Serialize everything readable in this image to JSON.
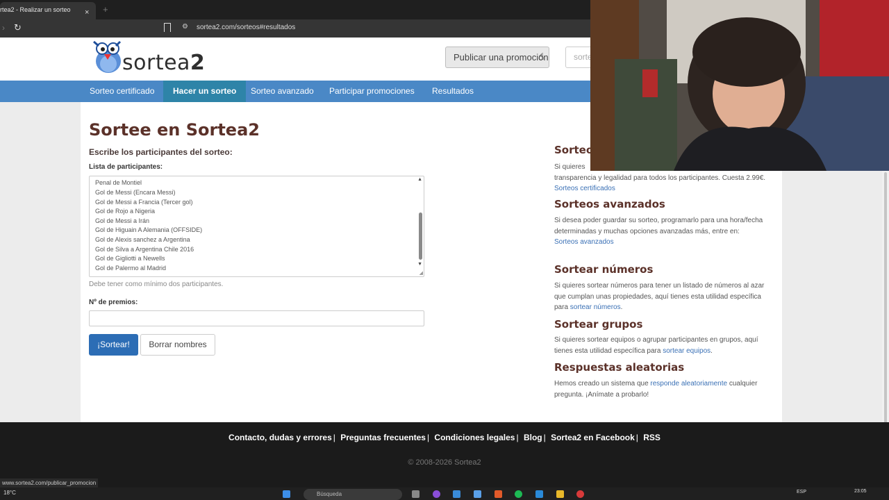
{
  "browser": {
    "tab_title": "rtea2 - Realizar un sorteo",
    "tab_close": "×",
    "new_tab": "+",
    "url": "sortea2.com/sorteos#resultados",
    "status_url": "www.sortea2.com/publicar_promocion"
  },
  "header": {
    "logo_text_light": "sortea",
    "logo_text_bold": "2",
    "publish_button": "Publicar una promoción",
    "search_placeholder": "sorte"
  },
  "nav": {
    "items": [
      {
        "label": "Sorteo certificado",
        "active": false
      },
      {
        "label": "Hacer un sorteo",
        "active": true
      },
      {
        "label": "Sorteo avanzado",
        "active": false
      },
      {
        "label": "Participar promociones",
        "active": false
      },
      {
        "label": "Resultados",
        "active": false
      }
    ]
  },
  "main": {
    "title": "Sortee en Sortea2",
    "subtitle": "Escribe los participantes del sorteo:",
    "list_label": "Lista de participantes:",
    "participants": [
      "Penal de Montiel",
      "Gol de Messi (Encara Messi)",
      "Gol de Messi a Francia (Tercer gol)",
      "Gol de Rojo a Nigeria",
      "Gol de Messi a Irán",
      "Gol de Higuain A Alemania (OFFSIDE)",
      "Gol de Alexis sanchez a Argentina",
      "Gol de Silva a Argentina Chile 2016",
      "Gol de Gigliotti a Newells",
      "Gol de Palermo al Madrid"
    ],
    "hint": "Debe tener como mínimo dos participantes.",
    "prizes_label": "Nº de premios:",
    "prizes_value": "",
    "sortear_button": "¡Sortear!",
    "borrar_button": "Borrar nombres"
  },
  "sidebar": {
    "certified_title": "Sorteo",
    "certified_text": "Si quieres",
    "certified_text2": "transparencia y legalidad para todos los participantes. Cuesta 2.99€.",
    "certified_link": "Sorteos certificados",
    "advanced_title": "Sorteos avanzados",
    "advanced_text": "Si desea poder guardar su sorteo, programarlo para una hora/fecha determinadas y muchas opciones avanzadas más, entre en:",
    "advanced_link": "Sorteos avanzados",
    "numbers_title": "Sortear números",
    "numbers_text": "Si quieres sortear números para tener un listado de números al azar que cumplan unas propiedades, aquí tienes esta utilidad específica para",
    "numbers_link": "sortear números",
    "groups_title": "Sortear grupos",
    "groups_text": "Si quieres sortear equipos o agrupar participantes en grupos, aquí tienes esta utilidad específica para",
    "groups_link": "sortear equipos",
    "random_title": "Respuestas aleatorias",
    "random_text1": "Hemos creado un sistema que",
    "random_link": "responde aleatoriamente",
    "random_text2": "cualquier pregunta. ¡Anímate a probarlo!"
  },
  "footer": {
    "links": [
      "Contacto, dudas y errores",
      "Preguntas frecuentes",
      "Condiciones legales",
      "Blog",
      "Sortea2 en Facebook",
      "RSS"
    ],
    "copyright": "© 2008-2026 Sortea2"
  },
  "taskbar": {
    "temperature": "18°C",
    "search_placeholder": "Búsqueda",
    "language": "ESP",
    "time": "23:05"
  },
  "colors": {
    "nav_blue": "#4a88c6",
    "nav_active": "#2e84a8",
    "title_brown": "#5b3129",
    "button_blue": "#2c6db5",
    "link_blue": "#3a70b5"
  }
}
